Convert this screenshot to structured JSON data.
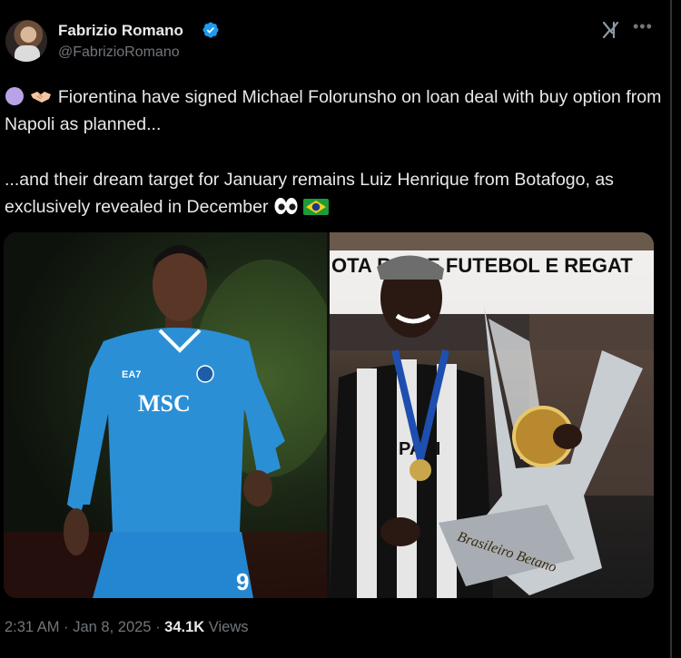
{
  "author": {
    "display_name": "Fabrizio Romano",
    "handle": "@FabrizioRomano",
    "verified": true
  },
  "header_icons": [
    "grok-icon",
    "more-icon"
  ],
  "tweet": {
    "paragraph_1": "Fiorentina have signed Michael Folorunsho on loan deal with buy option from Napoli as planned...",
    "paragraph_2": "...and their dream target for January remains Luiz Henrique from Botafogo, as exclusively revealed in December",
    "emojis_p1": [
      "purple-circle-icon",
      "handshake-icon"
    ],
    "emojis_p2": [
      "eyes-icon",
      "brazil-flag-icon"
    ]
  },
  "media": {
    "left_photo": {
      "sponsor": "MSC",
      "kit_maker": "EA7",
      "number": "9"
    },
    "right_photo": {
      "banner": "OTA   RO DE FUTEBOL E REGAT",
      "shirt_text": "PARI",
      "trophy_text": "Brasileiro Betano"
    }
  },
  "meta": {
    "time": "2:31 AM",
    "date": "Jan 8, 2025",
    "views_count": "34.1K",
    "views_label": "Views",
    "separator": "·"
  },
  "colors": {
    "background": "#000000",
    "text": "#e7e9ea",
    "muted": "#71767b",
    "verified": "#1d9bf0"
  }
}
